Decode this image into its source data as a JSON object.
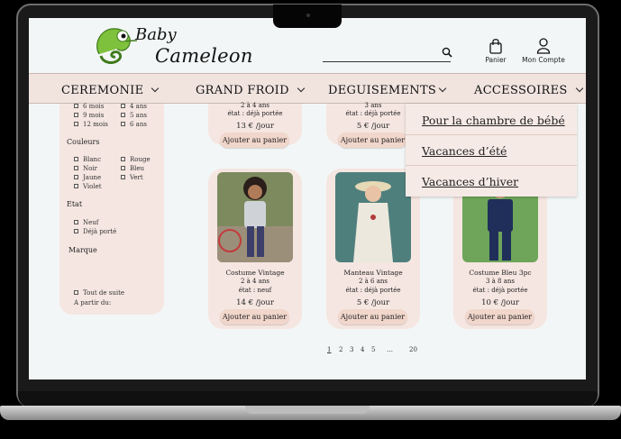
{
  "brand": {
    "line1": "Baby",
    "line2": "Cameleon"
  },
  "header": {
    "cart_label": "Panier",
    "account_label": "Mon Compte"
  },
  "nav": [
    "CEREMONIE",
    "GRAND FROID",
    "DEGUISEMENTS",
    "ACCESSOIRES"
  ],
  "dropdown": [
    "Pour la chambre de bébé",
    "Vacances d’été",
    "Vacances d’hiver"
  ],
  "sidebar": {
    "sizes": [
      "6 mois",
      "4 ans",
      "9 mois",
      "5 ans",
      "12 mois",
      "6 ans"
    ],
    "colors_title": "Couleurs",
    "colors": [
      "Blanc",
      "Rouge",
      "Noir",
      "Bleu",
      "Jaune",
      "Vert",
      "Violet"
    ],
    "state_title": "Etat",
    "states": [
      "Neuf",
      "Déjà porté"
    ],
    "brand_title": "Marque",
    "all": "Tout de suite",
    "from": "A partir du:"
  },
  "top_cards": [
    {
      "age": "2 à 4 ans",
      "state": "état : déjà portée",
      "price": "13 € /jour",
      "button": "Ajouter au panier"
    },
    {
      "age": "3 ans",
      "state": "état : déjà portée",
      "price": "5 € /jour",
      "button": "Ajouter au panier"
    }
  ],
  "products": [
    {
      "name": "Costume Vintage",
      "age": "2 à 4 ans",
      "state": "état : neuf",
      "price": "14 € /jour",
      "button": "Ajouter au panier"
    },
    {
      "name": "Manteau Vintage",
      "age": "2 à 6 ans",
      "state": "état : déjà portée",
      "price": "5 € /jour",
      "button": "Ajouter au panier"
    },
    {
      "name": "Costume Bleu 3pc",
      "age": "3 à 8 ans",
      "state": "état : déjà portée",
      "price": "10 € /jour",
      "button": "Ajouter au panier"
    }
  ],
  "pagination": [
    "1",
    "2",
    "3",
    "4",
    "5",
    "…",
    "20"
  ],
  "colors": {
    "nav_bg": "#f1e4df",
    "card_bg": "#f5e6e1",
    "button_bg": "#f1d6cb",
    "page_bg": "#f3f6f6"
  }
}
